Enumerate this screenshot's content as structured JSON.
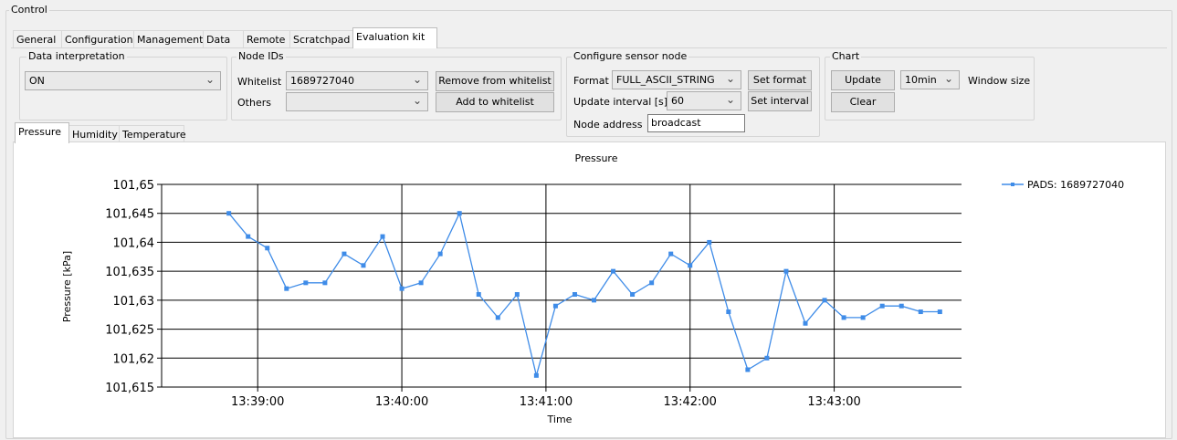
{
  "control_group": {
    "title": "Control"
  },
  "top_tabs": [
    {
      "label": "General"
    },
    {
      "label": "Configuration"
    },
    {
      "label": "Management"
    },
    {
      "label": "Data"
    },
    {
      "label": "Remote"
    },
    {
      "label": "Scratchpad"
    },
    {
      "label": "Evaluation kit"
    }
  ],
  "data_interpretation": {
    "title": "Data interpretation",
    "value": "ON"
  },
  "node_ids": {
    "title": "Node IDs",
    "whitelist_label": "Whitelist",
    "whitelist_value": "1689727040",
    "others_label": "Others",
    "others_value": "",
    "remove_button": "Remove from whitelist",
    "add_button": "Add to whitelist"
  },
  "configure_sensor": {
    "title": "Configure sensor node",
    "format_label": "Format",
    "format_value": "FULL_ASCII_STRING",
    "set_format_button": "Set format",
    "interval_label": "Update interval [s]",
    "interval_value": "60",
    "set_interval_button": "Set interval",
    "node_address_label": "Node address",
    "node_address_value": "broadcast"
  },
  "chart_controls": {
    "title": "Chart",
    "update_button": "Update",
    "clear_button": "Clear",
    "window_value": "10min",
    "window_label": "Window size"
  },
  "chart_tabs": [
    {
      "label": "Pressure"
    },
    {
      "label": "Humidity"
    },
    {
      "label": "Temperature"
    }
  ],
  "chart_data": {
    "type": "line",
    "title": "Pressure",
    "xlabel": "Time",
    "ylabel": "Pressure [kPa]",
    "ylim": [
      101.615,
      101.65
    ],
    "yticks": [
      101.615,
      101.62,
      101.625,
      101.63,
      101.635,
      101.64,
      101.645,
      101.65
    ],
    "ytick_labels": [
      "101,615",
      "101,62",
      "101,625",
      "101,63",
      "101,635",
      "101,64",
      "101,645",
      "101,65"
    ],
    "xlim": [
      "13:38:20",
      "13:43:53"
    ],
    "xticks": [
      "13:39:00",
      "13:40:00",
      "13:41:00",
      "13:42:00",
      "13:43:00"
    ],
    "grid": true,
    "legend_position": "top-right",
    "color": "#3f8ce8",
    "series": [
      {
        "name": "PADS: 1689727040",
        "x": [
          "13:38:48",
          "13:38:56",
          "13:39:04",
          "13:39:12",
          "13:39:20",
          "13:39:28",
          "13:39:36",
          "13:39:44",
          "13:39:52",
          "13:40:00",
          "13:40:08",
          "13:40:16",
          "13:40:24",
          "13:40:32",
          "13:40:40",
          "13:40:48",
          "13:40:56",
          "13:41:04",
          "13:41:12",
          "13:41:20",
          "13:41:28",
          "13:41:36",
          "13:41:44",
          "13:41:52",
          "13:42:00",
          "13:42:08",
          "13:42:16",
          "13:42:24",
          "13:42:32",
          "13:42:40",
          "13:42:48",
          "13:42:56",
          "13:43:04",
          "13:43:12",
          "13:43:20",
          "13:43:28",
          "13:43:36",
          "13:43:44"
        ],
        "y": [
          101.645,
          101.641,
          101.639,
          101.632,
          101.633,
          101.633,
          101.638,
          101.636,
          101.641,
          101.632,
          101.633,
          101.638,
          101.645,
          101.631,
          101.627,
          101.631,
          101.617,
          101.629,
          101.631,
          101.63,
          101.635,
          101.631,
          101.633,
          101.638,
          101.636,
          101.64,
          101.628,
          101.618,
          101.62,
          101.635,
          101.626,
          101.63,
          101.627,
          101.627,
          101.629,
          101.629,
          101.628,
          101.628
        ]
      }
    ]
  }
}
